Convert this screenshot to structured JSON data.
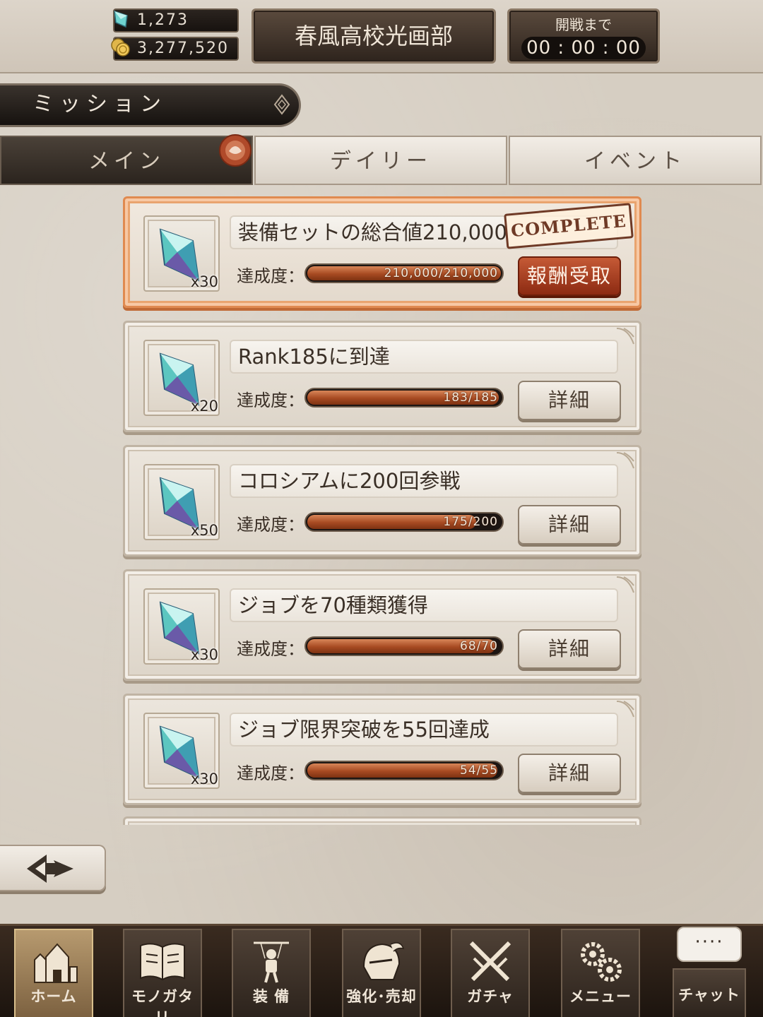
{
  "top_bar": {
    "gems": "1,273",
    "gold": "3,277,520",
    "guild_name": "春風高校光画部",
    "timer_label": "開戦まで",
    "timer_value": "00 : 00 : 00"
  },
  "header": {
    "title": "ミッション"
  },
  "tabs": [
    {
      "label": "メイン",
      "active": true
    },
    {
      "label": "デイリー",
      "active": false
    },
    {
      "label": "イベント",
      "active": false
    }
  ],
  "progress_label": "達成度：",
  "missions": [
    {
      "title": "装備セットの総合値210,000",
      "reward_qty": "x30",
      "progress_text": "210,000/210,000",
      "progress": 1.0,
      "status": "COMPLETE",
      "button": "報酬受取"
    },
    {
      "title": "Rank185に到達",
      "reward_qty": "x20",
      "progress_text": "183/185",
      "progress": 0.989,
      "button": "詳細"
    },
    {
      "title": "コロシアムに200回参戦",
      "reward_qty": "x50",
      "progress_text": "175/200",
      "progress": 0.875,
      "button": "詳細"
    },
    {
      "title": "ジョブを70種類獲得",
      "reward_qty": "x30",
      "progress_text": "68/70",
      "progress": 0.971,
      "button": "詳細"
    },
    {
      "title": "ジョブ限界突破を55回達成",
      "reward_qty": "x30",
      "progress_text": "54/55",
      "progress": 0.982,
      "button": "詳細"
    }
  ],
  "nav": {
    "home": "ホーム",
    "story": "モノガタリ",
    "equip": "装 備",
    "enhance": "強化･売却",
    "gacha": "ガチャ",
    "menu": "メニュー",
    "chat": "チャット",
    "chat_bubble": "····"
  },
  "colors": {
    "accent_orange": "#e08a50",
    "claim_red": "#8c2a12",
    "progress_fill": "#a74a22"
  }
}
